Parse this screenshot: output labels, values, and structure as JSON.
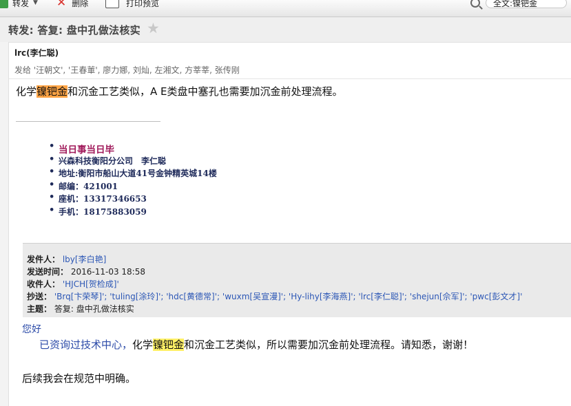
{
  "toolbar": {
    "forward_label": "转发",
    "delete_label": "删除",
    "print_preview_label": "打印预览"
  },
  "search": {
    "value": "全文:镍钯金"
  },
  "email": {
    "subject": "转发: 答复: 盘中孔做法核实",
    "sender": "lrc(李仁聪)",
    "recipients_line": "发给 '汪朝文', '王春莗', 廖力娜, 刘灿, 左湘文, 方莘莘, 张传刚",
    "body_line": {
      "before": "化学",
      "highlight": "镍钯金",
      "after": "和沉金工艺类似，A E类盘中塞孔也需要加沉金前处理流程。"
    },
    "signature": [
      "当日事当日毕",
      "兴森科技衡阳分公司　李仁聪",
      "地址:衡阳市船山大道41号金钟精英城14楼",
      "邮编：421001",
      "座机：13317346653",
      "手机：18175883059"
    ]
  },
  "quoted": {
    "from_label": "发件人：",
    "from_value": "lby[李白艳]",
    "sent_label": "发送时间：",
    "sent_value": "2016-11-03 18:58",
    "to_label": "收件人：",
    "to_value": "'HJCH[贺检成]'",
    "cc_label": "抄送：",
    "cc_value": "'Brq[卞荣琴]'; 'tuling[涂玲]'; 'hdc[黄德常]'; 'wuxm[吴宣漫]'; 'Hy-lihy[李海燕]'; 'lrc[李仁聪]'; 'shejun[佘军]'; 'pwc[彭文才]'",
    "subject_label": "主题：",
    "subject_value": "答复: 盘中孔做法核实",
    "greeting": "您好",
    "body_blue": "已资询过技术中心，",
    "body_before": "化学",
    "body_highlight": "镍钯金",
    "body_after": "和沉金工艺类似，所以需要加沉金前处理流程。请知悉，谢谢！",
    "closing": "后续我会在规范中明确。"
  },
  "colors": {
    "highlight_current": "#ffa445",
    "highlight_other": "#fff066",
    "link_blue": "#2b56b5"
  }
}
